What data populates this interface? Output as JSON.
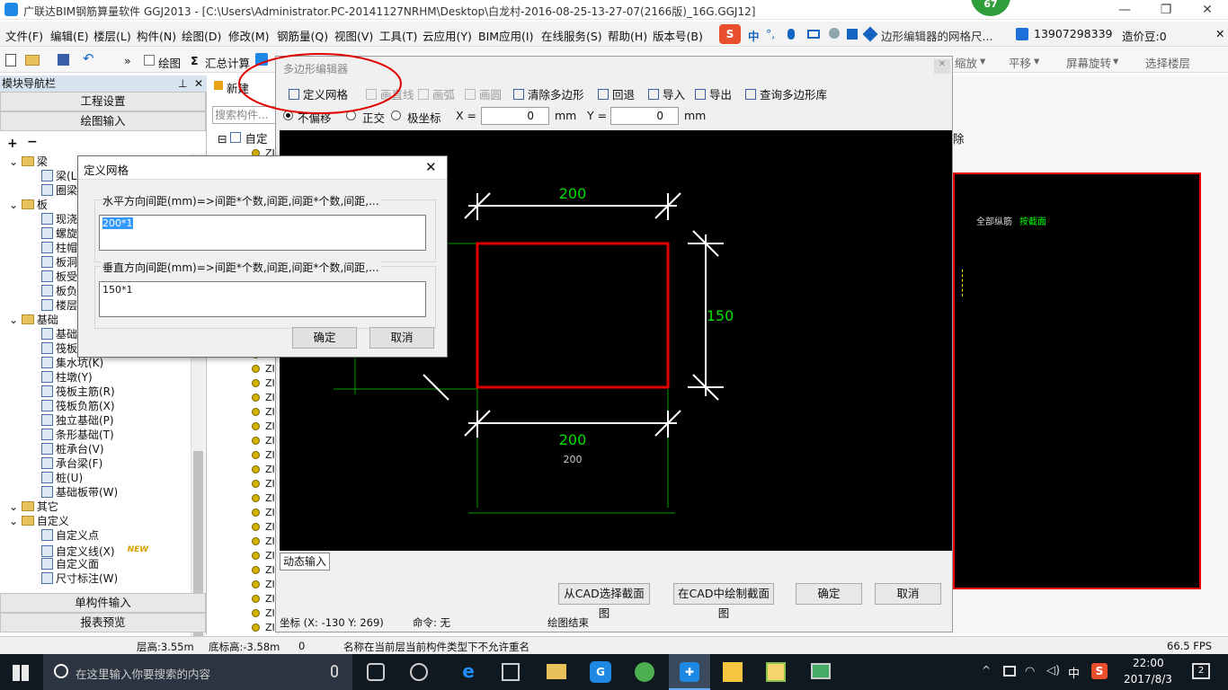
{
  "window": {
    "title": "广联达BIM钢筋算量软件 GGJ2013 - [C:\\Users\\Administrator.PC-20141127NRHM\\Desktop\\白龙村-2016-08-25-13-27-07(2166版)_16G.GGJ12]",
    "badge": "67"
  },
  "menu": [
    "文件(F)",
    "编辑(E)",
    "楼层(L)",
    "构件(N)",
    "绘图(D)",
    "修改(M)",
    "钢筋量(Q)",
    "视图(V)",
    "工具(T)",
    "云应用(Y)",
    "BIM应用(I)",
    "在线服务(S)",
    "帮助(H)",
    "版本号(B)"
  ],
  "ime": {
    "items": [
      "中",
      "°,"
    ]
  },
  "notice": "边形编辑器的网格尺...",
  "user": {
    "phone": "13907298339",
    "beans": "造价豆:0"
  },
  "toolbar": {
    "draw": "绘图",
    "sum": "汇总计算",
    "zoom": "缩放",
    "pan": "平移",
    "rotate": "屏幕旋转",
    "layers": "选择楼层"
  },
  "nav": {
    "header": "模块导航栏",
    "project": "工程设置",
    "drawing": "绘图输入",
    "single": "单构件输入",
    "report": "报表预览"
  },
  "tree": [
    {
      "t": "梁",
      "type": "folder",
      "lv": 0
    },
    {
      "t": "梁(L)",
      "type": "leaf",
      "lv": 1
    },
    {
      "t": "圈梁",
      "type": "leaf",
      "lv": 1
    },
    {
      "t": "板",
      "type": "folder",
      "lv": 0
    },
    {
      "t": "现浇",
      "type": "leaf",
      "lv": 1
    },
    {
      "t": "螺旋",
      "type": "leaf",
      "lv": 1
    },
    {
      "t": "柱帽",
      "type": "leaf",
      "lv": 1
    },
    {
      "t": "板洞",
      "type": "leaf",
      "lv": 1
    },
    {
      "t": "板受",
      "type": "leaf",
      "lv": 1
    },
    {
      "t": "板负",
      "type": "leaf",
      "lv": 1
    },
    {
      "t": "楼层",
      "type": "leaf",
      "lv": 1
    },
    {
      "t": "基础",
      "type": "folder",
      "lv": 0
    },
    {
      "t": "基础",
      "type": "leaf",
      "lv": 1
    },
    {
      "t": "筏板",
      "type": "leaf",
      "lv": 1
    },
    {
      "t": "集水坑(K)",
      "type": "leaf",
      "lv": 1
    },
    {
      "t": "柱墩(Y)",
      "type": "leaf",
      "lv": 1
    },
    {
      "t": "筏板主筋(R)",
      "type": "leaf",
      "lv": 1
    },
    {
      "t": "筏板负筋(X)",
      "type": "leaf",
      "lv": 1
    },
    {
      "t": "独立基础(P)",
      "type": "leaf",
      "lv": 1
    },
    {
      "t": "条形基础(T)",
      "type": "leaf",
      "lv": 1
    },
    {
      "t": "桩承台(V)",
      "type": "leaf",
      "lv": 1
    },
    {
      "t": "承台梁(F)",
      "type": "leaf",
      "lv": 1
    },
    {
      "t": "桩(U)",
      "type": "leaf",
      "lv": 1
    },
    {
      "t": "基础板带(W)",
      "type": "leaf",
      "lv": 1
    },
    {
      "t": "其它",
      "type": "folder",
      "lv": 0
    },
    {
      "t": "自定义",
      "type": "folder",
      "lv": 0
    },
    {
      "t": "自定义点",
      "type": "leaf",
      "lv": 1
    },
    {
      "t": "自定义线(X)",
      "type": "leaf",
      "lv": 1
    },
    {
      "t": "自定义面",
      "type": "leaf",
      "lv": 1
    },
    {
      "t": "尺寸标注(W)",
      "type": "leaf",
      "lv": 1
    }
  ],
  "newTag": "NEW",
  "mid": {
    "new": "新建",
    "search": "搜索构件...",
    "root": "自定",
    "item": "ZI"
  },
  "editor": {
    "title": "多边形编辑器",
    "tools": {
      "grid": "定义网格",
      "line": "画直线",
      "arc": "画弧",
      "circle": "画圆",
      "clear": "清除多边形",
      "undo": "回退",
      "import": "导入",
      "export": "导出",
      "query": "查询多边形库"
    },
    "modes": {
      "none": "不偏移",
      "ortho": "正交",
      "polar": "极坐标"
    },
    "x_label": "X =",
    "x_val": "0",
    "y_label": "Y =",
    "y_val": "0",
    "unit": "mm",
    "dyn": "动态输入",
    "from_cad": "从CAD选择截面图",
    "draw_cad": "在CAD中绘制截面图",
    "ok": "确定",
    "cancel": "取消",
    "coord": "坐标 (X: -130 Y: 269)",
    "cmd": "命令: 无",
    "end": "绘图结束"
  },
  "drawing": {
    "top_dim": "200",
    "right_dim": "150",
    "bottom_dim": "200",
    "bottom_small": "200"
  },
  "right": {
    "btn": "除",
    "label1": "全部纵筋",
    "label2": "按截面"
  },
  "dialog": {
    "title": "定义网格",
    "h_label": "水平方向间距(mm)=>间距*个数,间距,间距*个数,间距,...",
    "h_val": "200*1",
    "v_label": "垂直方向间距(mm)=>间距*个数,间距,间距*个数,间距,...",
    "v_val": "150*1",
    "ok": "确定",
    "cancel": "取消"
  },
  "status": {
    "floor_h": "层高:3.55m",
    "base_h": "底标高:-3.58m",
    "zero": "0",
    "msg": "名称在当前层当前构件类型下不允许重名",
    "fps": "66.5 FPS"
  },
  "taskbar": {
    "search": "在这里输入你要搜索的内容",
    "ime": "中",
    "time": "22:00",
    "date": "2017/8/3",
    "notif": "2"
  },
  "colors": {
    "accent": "#0078d7",
    "redline": "#e00000",
    "green": "#00e000"
  }
}
